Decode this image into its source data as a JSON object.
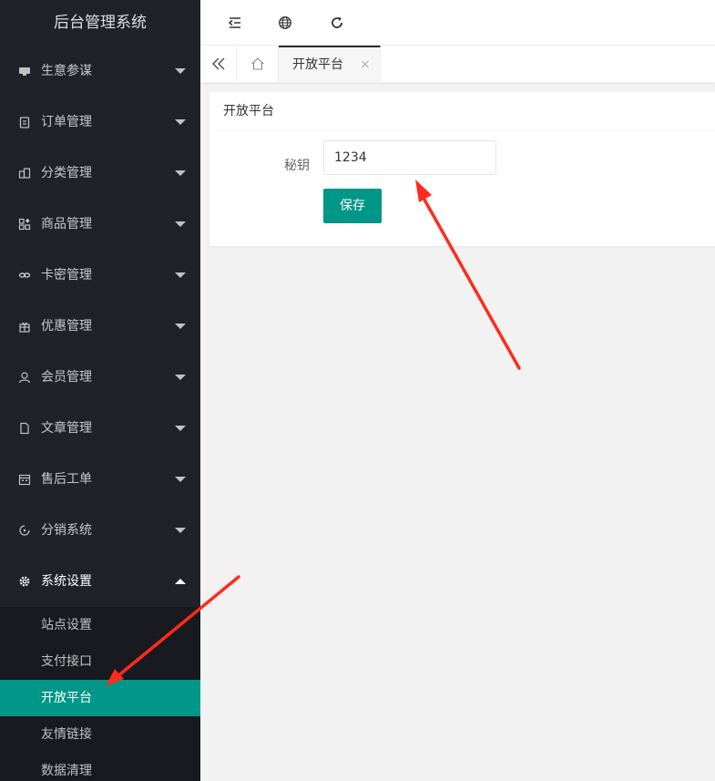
{
  "app": {
    "title": "后台管理系统"
  },
  "sidebar": {
    "items": [
      {
        "label": "生意参谋",
        "icon": "monitor-icon"
      },
      {
        "label": "订单管理",
        "icon": "clipboard-icon"
      },
      {
        "label": "分类管理",
        "icon": "category-icon"
      },
      {
        "label": "商品管理",
        "icon": "app-grid-icon"
      },
      {
        "label": "卡密管理",
        "icon": "link-icon"
      },
      {
        "label": "优惠管理",
        "icon": "gift-icon"
      },
      {
        "label": "会员管理",
        "icon": "user-icon"
      },
      {
        "label": "文章管理",
        "icon": "file-icon"
      },
      {
        "label": "售后工单",
        "icon": "calendar-icon"
      },
      {
        "label": "分销系统",
        "icon": "share-icon"
      },
      {
        "label": "系统设置",
        "icon": "gear-icon"
      }
    ],
    "sub_items": [
      {
        "label": "站点设置"
      },
      {
        "label": "支付接口"
      },
      {
        "label": "开放平台"
      },
      {
        "label": "友情链接"
      },
      {
        "label": "数据清理"
      }
    ],
    "active_sub": "开放平台"
  },
  "header": {
    "buttons": [
      "menu-fold-icon",
      "globe-icon",
      "refresh-icon"
    ]
  },
  "tabs": {
    "current": {
      "label": "开放平台",
      "close": "×"
    }
  },
  "card": {
    "title": "开放平台",
    "secret_label": "秘钥",
    "secret_value": "1234",
    "save_label": "保存"
  },
  "colors": {
    "sidebar_bg": "#20222a",
    "active_bg": "#009688",
    "annotation_arrow": "#ff2b1c"
  }
}
